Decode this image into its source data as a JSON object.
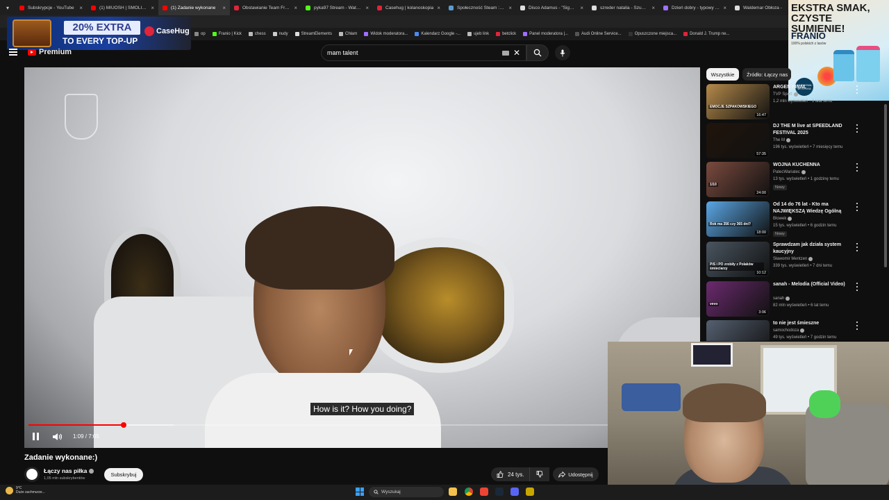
{
  "browser": {
    "tabs": [
      {
        "title": "Subskrypcje - YouTube",
        "color": "#ff0000",
        "active": false
      },
      {
        "title": "(1) MIUOSH | SMOLIK | M",
        "color": "#ff0000",
        "active": false
      },
      {
        "title": "(1) Zadanie wykonane",
        "color": "#ff0000",
        "active": true
      },
      {
        "title": "Obstawianie Team Franio",
        "color": "#e0243a",
        "active": false
      },
      {
        "title": "pyka97 Stream - Watch L",
        "color": "#53fc18",
        "active": false
      },
      {
        "title": "Casehug | kolanoskopia",
        "color": "#e0243a",
        "active": false
      },
      {
        "title": "Społeczność Steam :: kolo",
        "color": "#5b9bd5",
        "active": false
      },
      {
        "title": "Disco Adamus - \"Sigma B",
        "color": "#dddddd",
        "active": false
      },
      {
        "title": "szreder natalia - Szukaj w",
        "color": "#dddddd",
        "active": false
      },
      {
        "title": "Dzień dobry - typowy str",
        "color": "#a070ff",
        "active": false
      },
      {
        "title": "Waldemar Obłoza -",
        "color": "#dddddd",
        "active": false
      }
    ],
    "bookmarks": [
      {
        "label": "op",
        "color": "#888888"
      },
      {
        "label": "Franio | Kick",
        "color": "#53fc18"
      },
      {
        "label": "chess",
        "color": "#bbbbbb"
      },
      {
        "label": "nudy",
        "color": "#cccccc"
      },
      {
        "label": "StreamElements",
        "color": "#dddddd"
      },
      {
        "label": "Chłam",
        "color": "#bbbbbb"
      },
      {
        "label": "Widok moderatora...",
        "color": "#a070ff"
      },
      {
        "label": "Kalendarz Google -...",
        "color": "#4a8af4"
      },
      {
        "label": "ujeb link",
        "color": "#bbbbbb"
      },
      {
        "label": "betclick",
        "color": "#e0243a"
      },
      {
        "label": "Panel moderatora |...",
        "color": "#a070ff"
      },
      {
        "label": "Audi Online Service...",
        "color": "#555555"
      },
      {
        "label": "Opuszczone miejsca...",
        "color": "#333333"
      },
      {
        "label": "Donald J. Trump ne...",
        "color": "#e0243a"
      }
    ]
  },
  "ad_left": {
    "line1": "20% EXTRA",
    "line2": "TO EVERY TOP-UP",
    "brand": "CaseHug"
  },
  "ad_right": {
    "headline": "EKSTRA SMAK, CZYSTE SUMIENIE!",
    "brand": "FRANIO",
    "tagline": "100% polskich z lasów",
    "badge": "DARMOWA WYSYŁKA"
  },
  "header": {
    "logo_text": "Premium",
    "search_value": "mam talent"
  },
  "player": {
    "subtitle": "How is it? How you doing?",
    "time": "1:09 / 7:05",
    "progress_fraction": 0.164,
    "buffer_fraction": 0.25
  },
  "video": {
    "title": "Zadanie wykonane:)",
    "channel": "Łączy nas piłka",
    "subscribers": "1,05 mln subskrybentów",
    "subscribe_label": "Subskrybuj",
    "likes": "24 tys.",
    "share_label": "Udostępnij"
  },
  "sidebar": {
    "chips": [
      "Wszystkie",
      "Źródło: Łączy nas"
    ],
    "items": [
      {
        "title": "ARGEN FINAŁ",
        "channel": "TVP Sport",
        "meta": "1,2 mln wyświetleń • 3 lata temu",
        "duration": "16:47",
        "badge": "",
        "thumb_color": "#b58a4a",
        "thumb_text": "EMOCJE SZPAKOWSKIEGO"
      },
      {
        "title": "DJ THE M live at SPEEDLAND FESTIVAL 2025",
        "channel": "The M",
        "meta": "196 tys. wyświetleń • 7 miesięcy temu",
        "duration": "57:35",
        "badge": "",
        "thumb_color": "#20140c",
        "thumb_text": ""
      },
      {
        "title": "WOJNA KUCHENNA",
        "channel": "PatecWariatec",
        "meta": "13 tys. wyświetleń • 1 godzinę temu",
        "duration": "24:00",
        "badge": "Nowy",
        "thumb_color": "#7a4a3e",
        "thumb_text": "1/10"
      },
      {
        "title": "Od 14 do 76 lat - Kto ma NAJWIĘKSZĄ Wiedzę Ogólną",
        "channel": "Blowek",
        "meta": "15 tys. wyświetleń • 6 godzin temu",
        "duration": "18:00",
        "badge": "Nowy",
        "thumb_color": "#5aa7e6",
        "thumb_text": "Rok ma 356 czy 365 dni?"
      },
      {
        "title": "Sprawdzam jak działa system kaucyjny",
        "channel": "Sławomir Mentzen",
        "meta": "339 tys. wyświetleń • 7 dni temu",
        "duration": "10:12",
        "badge": "",
        "thumb_color": "#4a5560",
        "thumb_text": "PiS i PO zrobiły z Polaków śmieciarzy"
      },
      {
        "title": "sanah - Melodia (Official Video)",
        "channel": "sanah",
        "meta": "82 mln wyświetleń • 6 lat temu",
        "duration": "3:06",
        "badge": "",
        "thumb_color": "#6b2a6e",
        "thumb_text": "vevo"
      },
      {
        "title": "to nie jest śmieszne",
        "channel": "samochodoza",
        "meta": "49 tys. wyświetleń • 7 godzin temu",
        "duration": "",
        "badge": "",
        "thumb_color": "#556070",
        "thumb_text": ""
      }
    ]
  },
  "taskbar": {
    "weather_temp": "9°C",
    "weather_desc": "Duże zachmurze...",
    "search_label": "Wyszukaj"
  }
}
